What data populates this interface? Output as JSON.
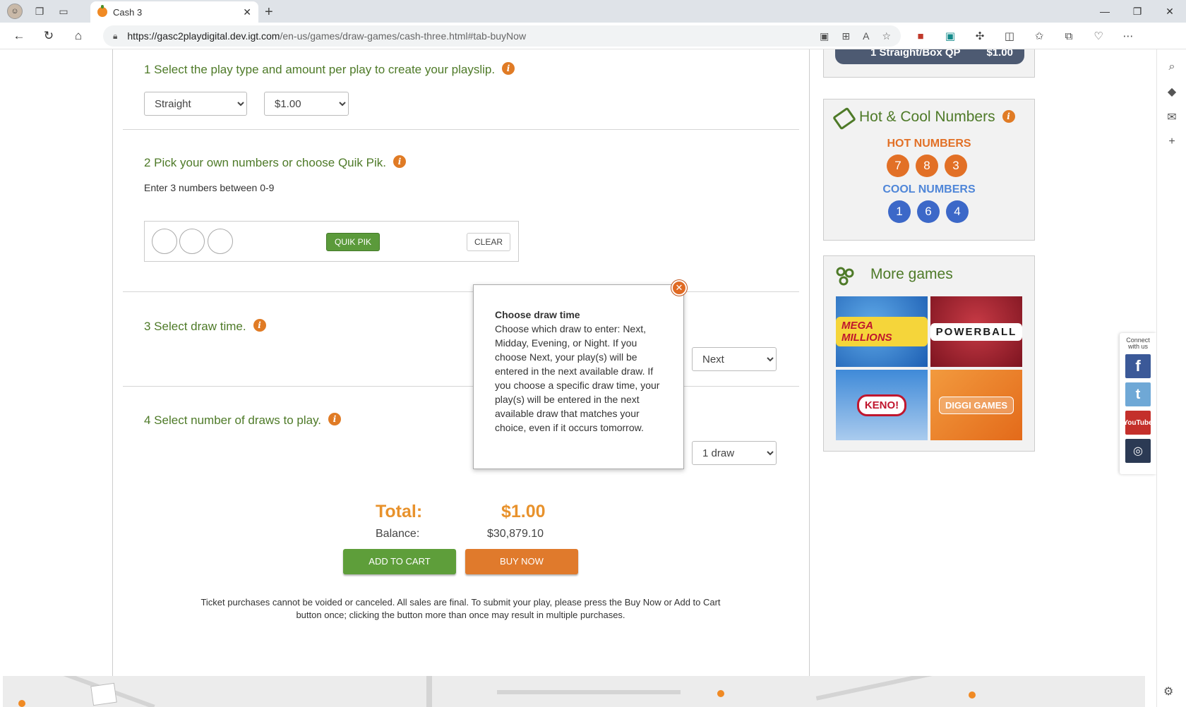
{
  "browser": {
    "tab_title": "Cash 3",
    "url_host": "https://gasc2playdigital.dev.igt.com",
    "url_path": "/en-us/games/draw-games/cash-three.html#tab-buyNow"
  },
  "steps": {
    "s1": {
      "title": "1 Select the play type and amount per play to create your playslip.",
      "play_type": "Straight",
      "amount": "$1.00"
    },
    "s2": {
      "title": "2 Pick your own numbers or choose Quik Pik.",
      "hint": "Enter 3 numbers between 0-9",
      "quik_pik": "QUIK PIK",
      "clear": "CLEAR"
    },
    "s3": {
      "title": "3 Select draw time.",
      "value": "Next"
    },
    "s4": {
      "title": "4 Select number of draws to play.",
      "value": "1 draw"
    }
  },
  "totals": {
    "total_label": "Total:",
    "total_value": "$1.00",
    "balance_label": "Balance:",
    "balance_value": "$30,879.10",
    "add_to_cart": "ADD TO CART",
    "buy_now": "BUY NOW",
    "disclaimer": "Ticket purchases cannot be voided or canceled. All sales are final. To submit your play, please press the Buy Now or Add to Cart button once; clicking the button more than once may result in multiple purchases."
  },
  "cart_pill": {
    "label": "1 Straight/Box QP",
    "price": "$1.00"
  },
  "hot_cool": {
    "title": "Hot & Cool Numbers",
    "hot_label": "HOT NUMBERS",
    "hot": [
      "7",
      "8",
      "3"
    ],
    "cool_label": "COOL NUMBERS",
    "cool": [
      "1",
      "6",
      "4"
    ]
  },
  "more_games": {
    "title": "More games",
    "tiles": [
      "MEGA MILLIONS",
      "POWERBALL",
      "KENO!",
      "DIGGI GAMES"
    ]
  },
  "social": {
    "caption": "Connect with us",
    "yt": "YouTube"
  },
  "popover": {
    "title": "Choose draw time",
    "body": "Choose which draw to enter: Next, Midday, Evening, or Night. If you choose Next, your play(s) will be entered in the next available draw. If you choose a specific draw time, your play(s) will be entered in the next available draw that matches your choice, even if it occurs tomorrow."
  },
  "colors": {
    "green": "#4e7a28",
    "orange": "#e07b25",
    "hot": "#e27026",
    "cool": "#3c68c8"
  }
}
